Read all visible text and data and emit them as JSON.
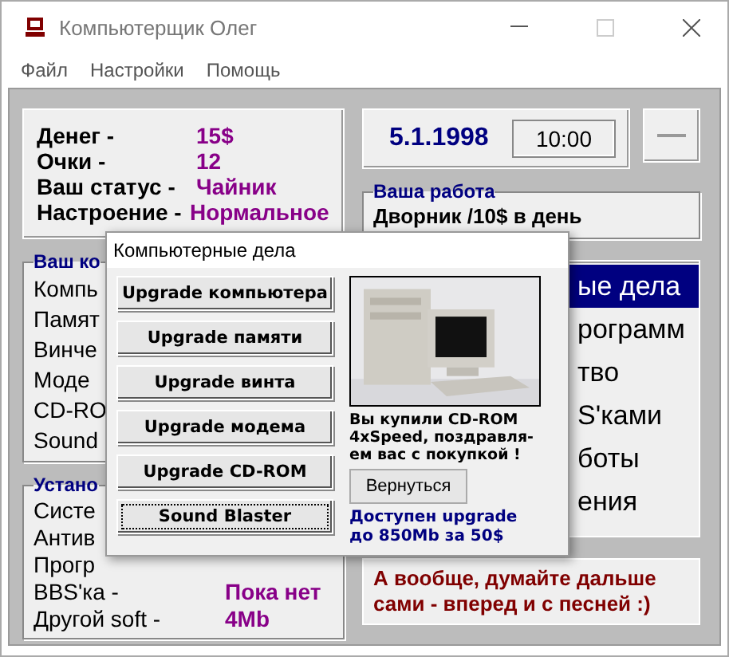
{
  "window": {
    "title": "Компьютерщик Олег"
  },
  "menu": [
    "Файл",
    "Настройки",
    "Помощь"
  ],
  "stats": [
    {
      "label": "Денег -",
      "value": "15$"
    },
    {
      "label": "Очки -",
      "value": "12"
    },
    {
      "label": "Ваш статус -",
      "value": "Чайник"
    },
    {
      "label": "Настроение -",
      "value": "Нормальное"
    }
  ],
  "date": "5.1.1998",
  "time": "10:00",
  "job": {
    "title": "Ваша работа",
    "text": "Дворник /10$ в день"
  },
  "computer": {
    "title": "Ваш ко",
    "rows": [
      "Компь",
      "Памят",
      "Винче",
      "Моде",
      "CD-RO",
      "Sound"
    ]
  },
  "software": {
    "title": "Устано",
    "rows": [
      {
        "label": "Систе"
      },
      {
        "label": "Антив"
      },
      {
        "label": "Прогр"
      },
      {
        "label": "BBS'ка -",
        "value": "Пока нет"
      },
      {
        "label": "Другой soft -",
        "value": "4Mb"
      }
    ]
  },
  "actions": [
    {
      "label": "ые дела",
      "selected": true
    },
    {
      "label": "рограмм",
      "selected": false
    },
    {
      "label": "тво",
      "selected": false
    },
    {
      "label": "S'ками",
      "selected": false
    },
    {
      "label": "боты",
      "selected": false
    },
    {
      "label": "ения",
      "selected": false
    }
  ],
  "message": "А вообще, думайте дальше сами - вперед и с песней :)",
  "dialog": {
    "title": "Компьютерные дела",
    "buttons": [
      {
        "label": "Upgrade компьютера",
        "focused": false
      },
      {
        "label": "Upgrade памяти",
        "focused": false
      },
      {
        "label": "Upgrade винта",
        "focused": false
      },
      {
        "label": "Upgrade модема",
        "focused": false
      },
      {
        "label": "Upgrade CD-ROM",
        "focused": false
      },
      {
        "label": "Sound Blaster",
        "focused": true
      }
    ],
    "info": "Вы купили CD-ROM 4xSpeed, поздравля-ем вас с покупкой !",
    "back_button": "Вернуться",
    "note": "Доступен upgrade до 850Mb за 50$"
  }
}
